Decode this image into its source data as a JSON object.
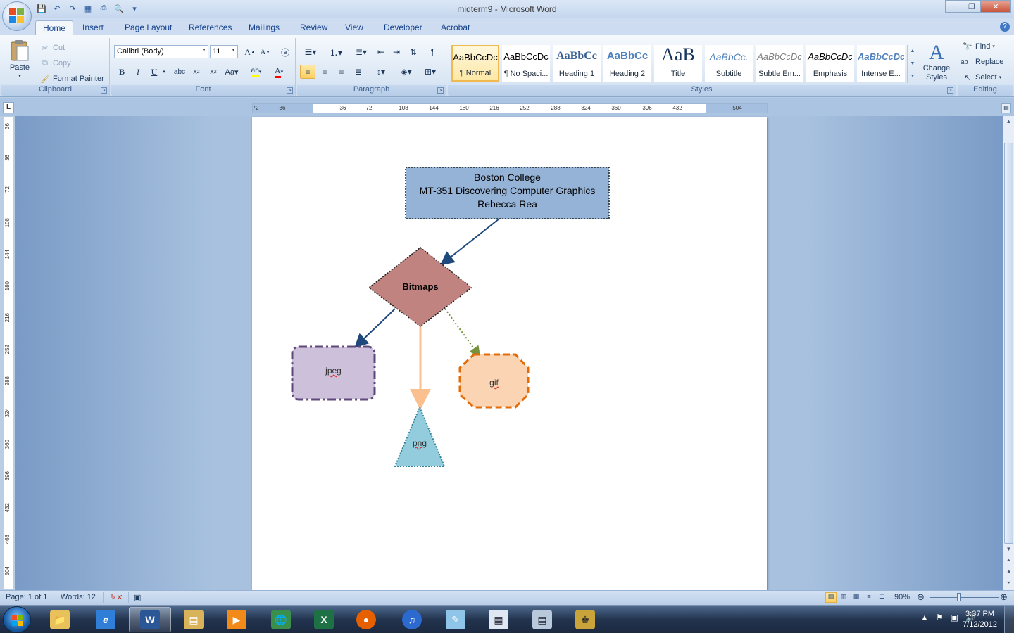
{
  "window": {
    "title": "midterm9 - Microsoft Word",
    "controls": {
      "minimize": "─",
      "maximize": "❐",
      "close": "✕"
    }
  },
  "quick_access": [
    "save-icon",
    "undo-icon",
    "redo-icon",
    "print-preview-icon",
    "quick-print-icon",
    "customize-icon"
  ],
  "tabs": [
    "Home",
    "Insert",
    "Page Layout",
    "References",
    "Mailings",
    "Review",
    "View",
    "Developer",
    "Acrobat"
  ],
  "active_tab": "Home",
  "ribbon": {
    "clipboard": {
      "label": "Clipboard",
      "paste": "Paste",
      "cut": "Cut",
      "copy": "Copy",
      "format_painter": "Format Painter"
    },
    "font": {
      "label": "Font",
      "font_name": "Calibri (Body)",
      "font_size": "11",
      "text_color": "#ff0000",
      "highlight_color": "#ffff00"
    },
    "paragraph": {
      "label": "Paragraph"
    },
    "styles": {
      "label": "Styles",
      "items": [
        {
          "sample": "AaBbCcDc",
          "name": "¶ Normal"
        },
        {
          "sample": "AaBbCcDc",
          "name": "¶ No Spaci..."
        },
        {
          "sample": "AaBbCc",
          "name": "Heading 1"
        },
        {
          "sample": "AaBbCc",
          "name": "Heading 2"
        },
        {
          "sample": "AaB",
          "name": "Title"
        },
        {
          "sample": "AaBbCc.",
          "name": "Subtitle"
        },
        {
          "sample": "AaBbCcDc",
          "name": "Subtle Em..."
        },
        {
          "sample": "AaBbCcDc",
          "name": "Emphasis"
        },
        {
          "sample": "AaBbCcDc",
          "name": "Intense E..."
        }
      ],
      "change_styles": "Change Styles"
    },
    "editing": {
      "label": "Editing",
      "find": "Find",
      "replace": "Replace",
      "select": "Select"
    }
  },
  "ruler": {
    "horizontal": [
      "72",
      "36",
      "36",
      "72",
      "108",
      "144",
      "180",
      "216",
      "252",
      "288",
      "324",
      "360",
      "396",
      "432",
      "504"
    ],
    "vertical": [
      "36",
      "36",
      "72",
      "108",
      "144",
      "180",
      "216",
      "252",
      "288",
      "324",
      "360",
      "396",
      "432",
      "468",
      "504"
    ]
  },
  "document": {
    "header_box": {
      "lines": [
        "Boston College",
        "MT-351 Discovering Computer Graphics",
        "Rebecca Rea"
      ]
    },
    "diamond": "Bitmaps",
    "jpeg": "jpeg",
    "png": "png",
    "gif": "gif",
    "colors": {
      "header_fill": "#95b3d7",
      "diamond_fill": "#c0837f",
      "jpeg_fill": "#ccc0da",
      "jpeg_stroke": "#5f497a",
      "png_fill": "#93cddd",
      "png_stroke": "#31859c",
      "gif_fill": "#fbd4b4",
      "gif_stroke": "#e36c09",
      "arrow_blue": "#1f497d",
      "arrow_peach": "#fac090",
      "arrow_olive": "#76923c"
    }
  },
  "statusbar": {
    "page": "Page: 1 of 1",
    "words": "Words: 12",
    "zoom": "90%"
  },
  "taskbar": {
    "apps": [
      "windows-explorer",
      "internet-explorer",
      "microsoft-word",
      "libraries",
      "media-player",
      "network",
      "excel",
      "firefox",
      "itunes",
      "notepad",
      "calculator-grid",
      "calculator",
      "game"
    ],
    "clock_time": "3:37 PM",
    "clock_date": "7/12/2012"
  }
}
